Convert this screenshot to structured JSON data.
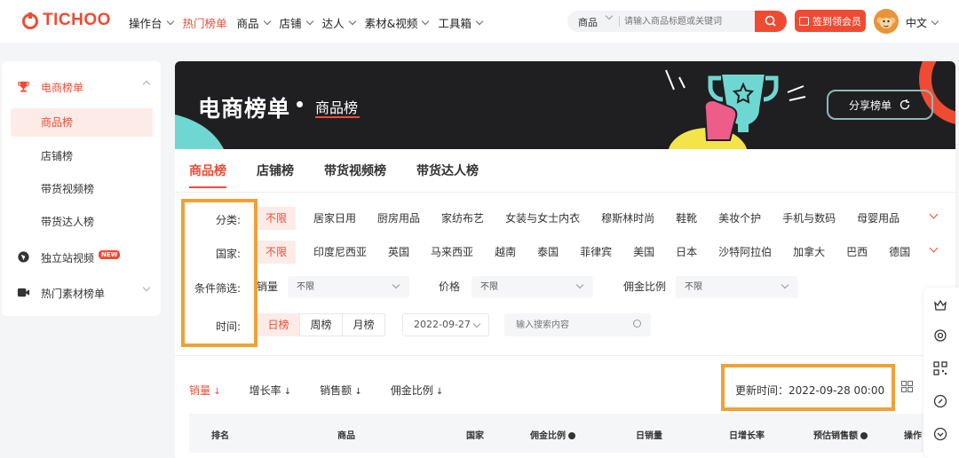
{
  "brand": {
    "name": "TICHOO",
    "color": "#ef4b33"
  },
  "nav": {
    "items": [
      {
        "label": "操作台",
        "dropdown": true,
        "active": false
      },
      {
        "label": "热门榜单",
        "dropdown": false,
        "active": true
      },
      {
        "label": "商品",
        "dropdown": true,
        "active": false
      },
      {
        "label": "店铺",
        "dropdown": true,
        "active": false
      },
      {
        "label": "达人",
        "dropdown": true,
        "active": false
      },
      {
        "label": "素材&视频",
        "dropdown": true,
        "active": false
      },
      {
        "label": "工具箱",
        "dropdown": true,
        "active": false
      }
    ]
  },
  "search": {
    "category": "商品",
    "placeholder": "请输入商品标题或关键词",
    "icon": "search-icon"
  },
  "header": {
    "vip_label": "签到领会员",
    "lang_label": "中文"
  },
  "sidebar": {
    "sections": [
      {
        "label": "电商榜单",
        "icon": "trophy-icon",
        "expanded": true,
        "active": true
      },
      {
        "label": "独立站视频",
        "icon": "globe-icon",
        "badge": "NEW"
      },
      {
        "label": "热门素材榜单",
        "icon": "video-icon",
        "expanded": false
      }
    ],
    "sub_items": [
      {
        "label": "商品榜",
        "active": true
      },
      {
        "label": "店铺榜",
        "active": false
      },
      {
        "label": "带货视频榜",
        "active": false
      },
      {
        "label": "带货达人榜",
        "active": false
      }
    ]
  },
  "banner": {
    "title": "电商榜单",
    "subtitle": "商品榜",
    "share_label": "分享榜单"
  },
  "tabs": [
    {
      "label": "商品榜",
      "active": true
    },
    {
      "label": "店铺榜",
      "active": false
    },
    {
      "label": "带货视频榜",
      "active": false
    },
    {
      "label": "带货达人榜",
      "active": false
    }
  ],
  "filters": {
    "category": {
      "label": "分类:",
      "options": [
        "不限",
        "居家日用",
        "厨房用品",
        "家纺布艺",
        "女装与女士内衣",
        "穆斯林时尚",
        "鞋靴",
        "美妆个护",
        "手机与数码",
        "母婴用品"
      ]
    },
    "country": {
      "label": "国家:",
      "options": [
        "不限",
        "印度尼西亚",
        "英国",
        "马来西亚",
        "越南",
        "泰国",
        "菲律宾",
        "美国",
        "日本",
        "沙特阿拉伯",
        "加拿大",
        "巴西",
        "德国"
      ]
    },
    "conditions": {
      "label": "条件筛选:",
      "items": [
        {
          "label": "销量",
          "value": "不限"
        },
        {
          "label": "价格",
          "value": "不限"
        },
        {
          "label": "佣金比例",
          "value": "不限"
        }
      ]
    },
    "time": {
      "label": "时间:",
      "options": [
        "日榜",
        "周榜",
        "月榜"
      ],
      "date": "2022-09-27",
      "keyword_placeholder": "输入搜索内容"
    }
  },
  "sort_options": [
    {
      "label": "销量",
      "active": true
    },
    {
      "label": "增长率",
      "active": false
    },
    {
      "label": "销售额",
      "active": false
    },
    {
      "label": "佣金比例",
      "active": false
    }
  ],
  "update_time": "更新时间：2022-09-28 00:00",
  "table": {
    "columns": [
      "排名",
      "商品",
      "国家",
      "佣金比例",
      "日销量",
      "日增长率",
      "预估销售额",
      "操作"
    ]
  },
  "right_tools": [
    "crown-icon",
    "target-icon",
    "qr-code-icon",
    "link-icon",
    "chevron-circle-icon"
  ],
  "colors": {
    "accent": "#ef4b33",
    "highlight": "#f0a133",
    "banner_bg": "#1f1f22"
  }
}
